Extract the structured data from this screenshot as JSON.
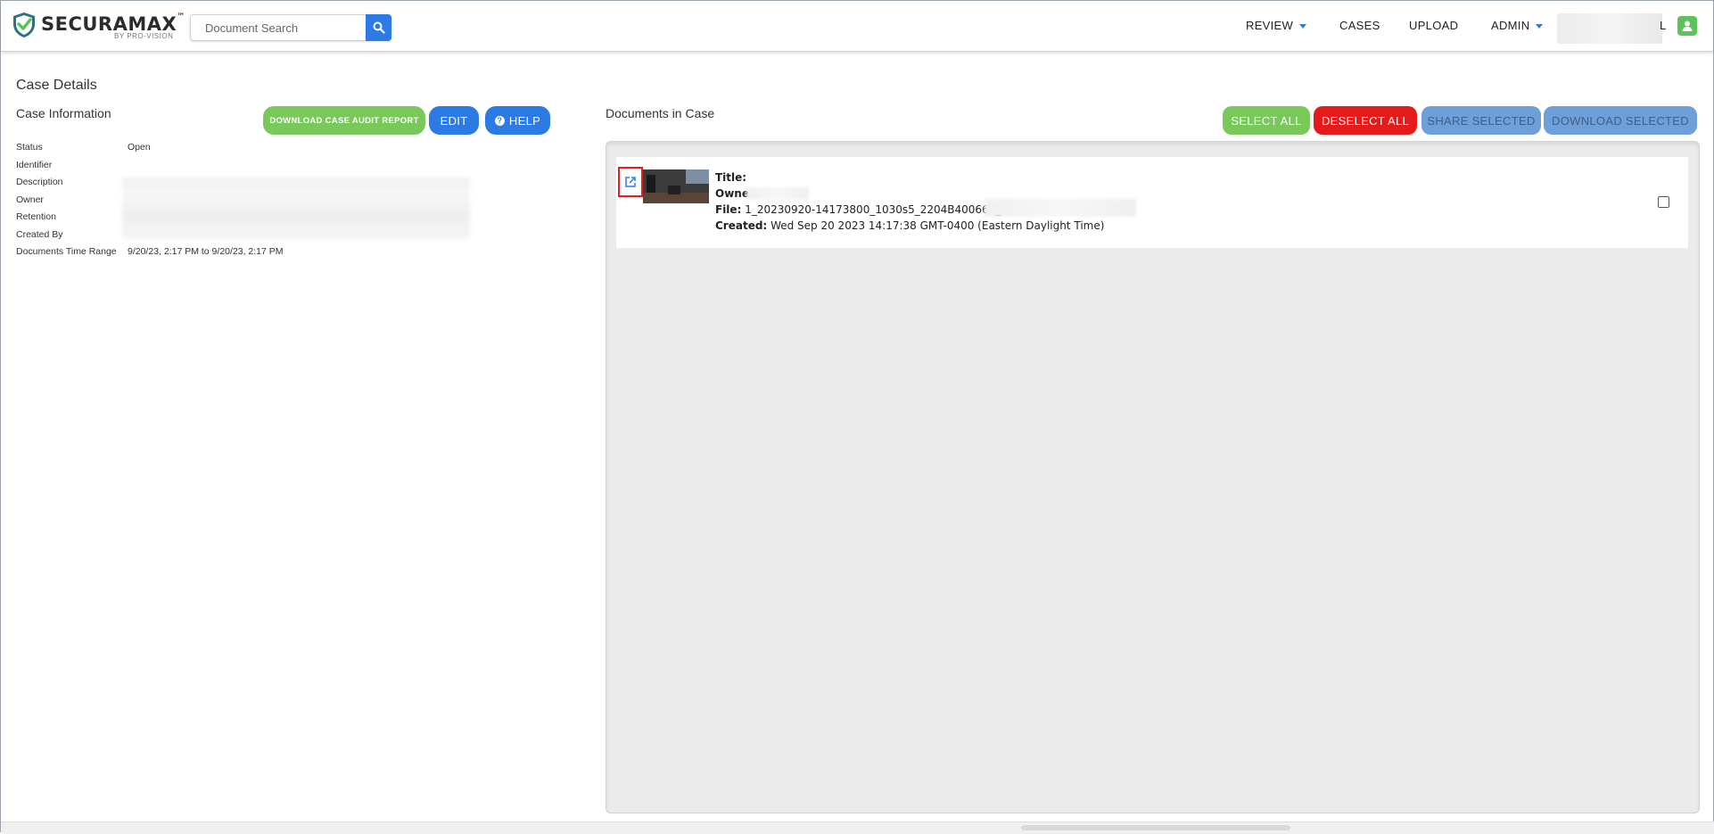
{
  "header": {
    "brand": "SECURAMAX",
    "brand_tm": "™",
    "brand_sub": "BY PRO-VISION",
    "search_placeholder": "Document Search",
    "nav": {
      "review": "REVIEW",
      "cases": "CASES",
      "upload": "UPLOAD",
      "admin": "ADMIN"
    },
    "user_visible_letter": "L"
  },
  "page": {
    "title": "Case Details"
  },
  "case_info": {
    "heading": "Case Information",
    "buttons": {
      "audit": "DOWNLOAD CASE AUDIT REPORT",
      "edit": "EDIT",
      "help": "HELP"
    },
    "rows": [
      {
        "label": "Status",
        "value": "Open"
      },
      {
        "label": "Identifier",
        "value": ""
      },
      {
        "label": "Description",
        "value": ""
      },
      {
        "label": "Owner",
        "value": ""
      },
      {
        "label": "Retention",
        "value": ""
      },
      {
        "label": "Created By",
        "value": ""
      },
      {
        "label": "Documents Time Range",
        "value": "9/20/23, 2:17 PM to 9/20/23, 2:17 PM"
      }
    ]
  },
  "documents": {
    "heading": "Documents in Case",
    "buttons": {
      "select_all": "SELECT ALL",
      "deselect_all": "DESELECT ALL",
      "share_selected": "SHARE SELECTED",
      "download_selected": "DOWNLOAD SELECTED"
    },
    "items": [
      {
        "title_label": "Title:",
        "owner_label": "Owner",
        "file_label": "File:",
        "file_value": "1_20230920-14173800_1030s5_2204B400664_r",
        "created_label": "Created:",
        "created_value": "Wed Sep 20 2023 14:17:38 GMT-0400 (Eastern Daylight Time)",
        "checked": false
      }
    ]
  },
  "colors": {
    "accent_blue": "#2c7be5",
    "green": "#78c85a",
    "red": "#e51b1b",
    "disabled_blue": "#6e9fd8",
    "highlight_red": "#e02020"
  }
}
